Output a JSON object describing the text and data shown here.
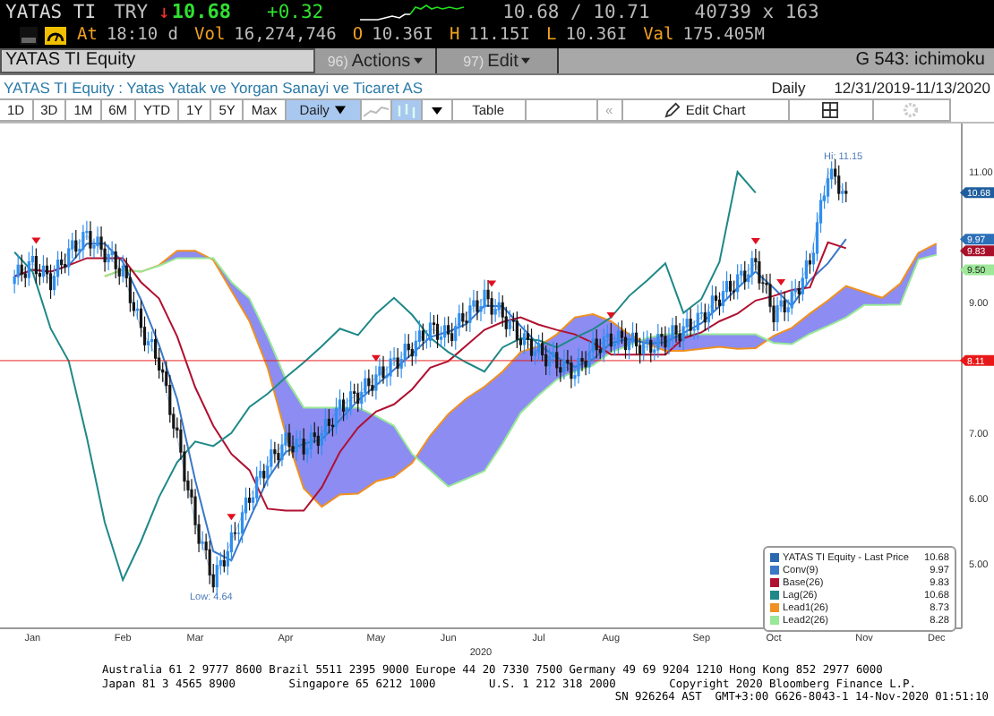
{
  "quote": {
    "ticker": "YATAS TI",
    "currency": "TRY",
    "arrow": "↓",
    "last": "10.68",
    "change": "+0.32",
    "bid_ask": "10.68 / 10.71",
    "size": "40739 x 163"
  },
  "quote_details": [
    {
      "label": "At",
      "value": "18:10 d"
    },
    {
      "label": "Vol",
      "value": "16,274,746"
    },
    {
      "label": "O",
      "value": "10.36I"
    },
    {
      "label": "H",
      "value": "11.15I"
    },
    {
      "label": "L",
      "value": "10.36I"
    },
    {
      "label": "Val",
      "value": "175.405M"
    }
  ],
  "command_bar": {
    "security": "YATAS TI Equity",
    "menus": [
      {
        "number": "96)",
        "label": "Actions"
      },
      {
        "number": "97)",
        "label": "Edit"
      }
    ],
    "function": "G 543: ichimoku"
  },
  "title_bar": {
    "description": "YATAS TI Equity : Yatas Yatak ve Yorgan Sanayi ve Ticaret AS",
    "frequency": "Daily",
    "date_range": "12/31/2019-11/13/2020"
  },
  "toolbar": {
    "periods": [
      "1D",
      "3D",
      "1M",
      "6M",
      "YTD",
      "1Y",
      "5Y",
      "Max"
    ],
    "frequency": "Daily",
    "table": "Table",
    "back": "«",
    "edit_chart": "Edit Chart"
  },
  "chart": {
    "chart_data": {
      "type": "line",
      "categories": [
        null,
        "Jan",
        null,
        null,
        null,
        null,
        "Feb",
        null,
        null,
        null,
        "Mar",
        null,
        null,
        null,
        null,
        "Apr",
        null,
        null,
        null,
        null,
        "May",
        null,
        null,
        null,
        "Jun",
        null,
        null,
        null,
        null,
        "Jul",
        null,
        null,
        null,
        "Aug",
        null,
        null,
        null,
        null,
        "Sep",
        null,
        null,
        null,
        "Oct",
        null,
        null,
        null,
        null,
        "Nov",
        null,
        null,
        null,
        "Dec"
      ],
      "series": [
        {
          "name": "YATAS TI Equity - Last Price",
          "color": "#2a68b0",
          "values": [
            9.4,
            9.6,
            9.34,
            9.78,
            10.02,
            9.77,
            9.47,
            8.6,
            8.1,
            6.93,
            5.63,
            4.75,
            5.34,
            6.02,
            6.55,
            6.87,
            6.8,
            7.0,
            7.4,
            7.6,
            7.85,
            8.08,
            8.33,
            8.6,
            8.5,
            8.83,
            9.07,
            8.81,
            8.46,
            8.24,
            8.08,
            7.94,
            8.31,
            8.45,
            8.42,
            8.31,
            8.46,
            8.59,
            8.77,
            9.1,
            9.34,
            9.6,
            8.84,
            9.05,
            9.62,
            11.0,
            10.68,
            null,
            null,
            null,
            null,
            null
          ]
        },
        {
          "name": "Conv(9)",
          "color": "#3a78c8",
          "values": [
            9.4,
            9.5,
            9.47,
            9.56,
            9.9,
            9.9,
            9.62,
            9.04,
            8.35,
            7.52,
            6.28,
            5.19,
            5.05,
            5.68,
            6.29,
            6.71,
            6.84,
            6.9,
            7.2,
            7.5,
            7.73,
            7.97,
            8.21,
            8.47,
            8.55,
            8.67,
            8.95,
            8.94,
            8.64,
            8.35,
            8.16,
            8.01,
            8.13,
            8.38,
            8.44,
            8.37,
            8.39,
            8.53,
            8.68,
            8.94,
            9.22,
            9.47,
            9.22,
            8.95,
            9.34,
            9.6,
            9.97,
            null,
            null,
            null,
            null,
            null
          ]
        },
        {
          "name": "Base(26)",
          "color": "#b01030",
          "values": [
            9.4,
            9.5,
            9.47,
            9.57,
            9.68,
            9.68,
            9.68,
            9.31,
            9.06,
            8.48,
            7.7,
            7.11,
            6.68,
            6.43,
            5.84,
            5.81,
            5.81,
            6.17,
            6.71,
            7.08,
            7.33,
            7.44,
            7.67,
            8.0,
            8.1,
            8.34,
            8.58,
            8.7,
            8.77,
            8.66,
            8.58,
            8.51,
            8.38,
            8.2,
            8.2,
            8.2,
            8.2,
            8.45,
            8.54,
            8.71,
            8.83,
            9.03,
            9.1,
            9.19,
            9.23,
            9.92,
            9.83,
            null,
            null,
            null,
            null,
            null
          ]
        },
        {
          "name": "Lag(26)",
          "color": "#1f8888",
          "values": [
            9.77,
            9.47,
            8.6,
            8.1,
            6.93,
            5.63,
            4.75,
            5.34,
            6.02,
            6.55,
            6.87,
            6.8,
            7.0,
            7.4,
            7.6,
            7.85,
            8.08,
            8.33,
            8.6,
            8.5,
            8.83,
            9.07,
            8.81,
            8.46,
            8.24,
            8.08,
            7.94,
            8.31,
            8.45,
            8.42,
            8.31,
            8.46,
            8.59,
            8.77,
            9.1,
            9.34,
            9.6,
            8.84,
            9.05,
            9.62,
            11.0,
            10.68,
            null,
            null,
            null,
            null,
            null,
            null,
            null,
            null,
            null,
            null
          ]
        },
        {
          "name": "Lead1(26)",
          "color": "#f09020",
          "values": [
            null,
            null,
            null,
            null,
            null,
            9.4,
            9.5,
            9.47,
            9.57,
            9.79,
            9.79,
            9.65,
            9.18,
            8.71,
            8.0,
            6.99,
            6.15,
            5.87,
            6.06,
            6.07,
            6.26,
            6.33,
            6.54,
            6.96,
            7.29,
            7.53,
            7.71,
            7.94,
            8.24,
            8.33,
            8.51,
            8.77,
            8.82,
            8.71,
            8.51,
            8.37,
            8.26,
            8.26,
            8.29,
            8.32,
            8.29,
            8.3,
            8.49,
            8.61,
            8.83,
            9.03,
            9.25,
            9.16,
            9.07,
            9.29,
            9.76,
            9.9
          ]
        },
        {
          "name": "Lead2(26)",
          "color": "#98e898",
          "values": [
            null,
            null,
            null,
            null,
            null,
            9.4,
            9.5,
            9.47,
            9.56,
            9.68,
            9.68,
            9.68,
            9.31,
            9.06,
            8.48,
            7.83,
            7.39,
            7.39,
            7.39,
            7.39,
            7.26,
            7.11,
            6.68,
            6.43,
            6.18,
            6.3,
            6.42,
            6.84,
            7.31,
            7.58,
            7.82,
            7.94,
            8.04,
            8.24,
            8.34,
            8.46,
            8.51,
            8.51,
            8.51,
            8.51,
            8.51,
            8.51,
            8.38,
            8.36,
            8.52,
            8.64,
            8.77,
            8.96,
            8.96,
            8.97,
            9.66,
            9.73
          ]
        }
      ],
      "ylim": [
        4.01,
        11.74
      ],
      "legend": "lower right",
      "xlabel": "2020",
      "yticks": [
        {
          "value": 11,
          "label": "11.00"
        },
        {
          "value": 9,
          "label": "9.00"
        },
        {
          "value": 7,
          "label": "7.00"
        },
        {
          "value": 6,
          "label": "6.00"
        },
        {
          "value": 5,
          "label": "5.00"
        }
      ]
    },
    "price_tags": [
      {
        "value": "10.68",
        "color": "#1f5e9e"
      },
      {
        "value": "9.97",
        "color": "#2a6fb8"
      },
      {
        "value": "9.83",
        "color": "#a8102a"
      },
      {
        "value": "9.50",
        "color": "#9ee89a"
      },
      {
        "value": "8.11",
        "color": "#e81818"
      }
    ],
    "legend_values": [
      "10.68",
      "9.97",
      "9.83",
      "10.68",
      "8.73",
      "8.28"
    ],
    "high_label": "Hi: 11.15",
    "low_label": "Low: 4.64"
  },
  "footer": [
    "Australia 61 2 9777 8600 Brazil 5511 2395 9000 Europe 44 20 7330 7500 Germany 49 69 9204 1210 Hong Kong 852 2977 6000",
    "Japan 81 3 4565 8900        Singapore 65 6212 1000        U.S. 1 212 318 2000        Copyright 2020 Bloomberg Finance L.P.",
    "SN 926264 AST  GMT+3:00 G626-8043-1 14-Nov-2020 01:51:10"
  ]
}
